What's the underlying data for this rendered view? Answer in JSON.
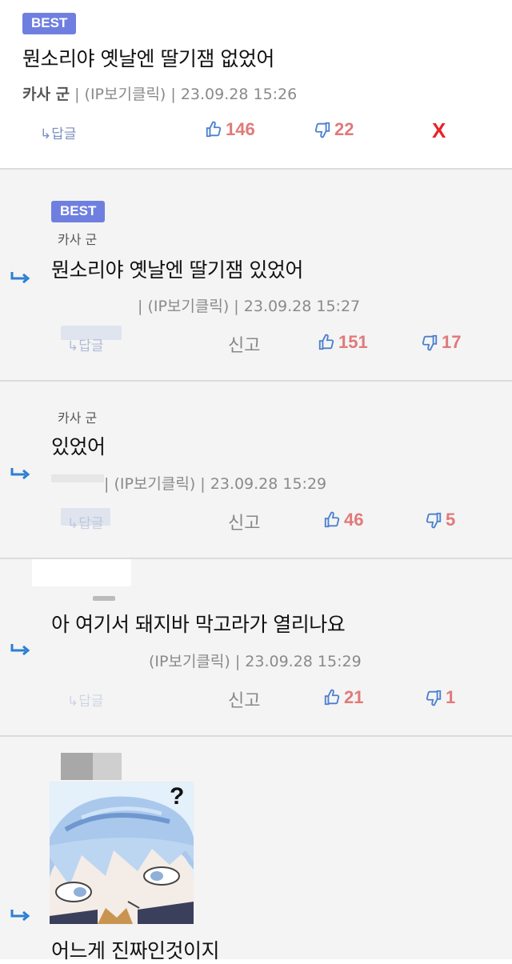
{
  "comments": [
    {
      "badge": "BEST",
      "text": "뭔소리야 옛날엔 딸기잼 없었어",
      "author": "카사 군",
      "meta": " | (IP보기클릭) | 23.09.28 15:26",
      "reply_label": "↳답글",
      "up": "146",
      "down": "22",
      "delete": "X"
    },
    {
      "badge": "BEST",
      "author": "카사 군",
      "text": "뭔소리야 옛날엔 딸기잼 있었어",
      "meta": " | (IP보기클릭) | 23.09.28 15:27",
      "reply_label": "↳답글",
      "report": "신고",
      "up": "151",
      "down": "17"
    },
    {
      "author": "카사 군",
      "text": "있었어",
      "meta": "| (IP보기클릭) | 23.09.28 15:29",
      "reply_label": "↳답글",
      "report": "신고",
      "up": "46",
      "down": "5"
    },
    {
      "text": "아 여기서 돼지바 막고라가 열리나요",
      "meta": "(IP보기클릭) | 23.09.28 15:29",
      "reply_label": "↳답글",
      "report": "신고",
      "up": "21",
      "down": "1"
    },
    {
      "image_question": "?",
      "text": "어느게 진짜인것이지"
    }
  ],
  "colors": {
    "badge": "#6f7fe0",
    "vote": "#e07a7a",
    "delete": "#e8232a",
    "reply_arrow": "#2a7fd4"
  }
}
